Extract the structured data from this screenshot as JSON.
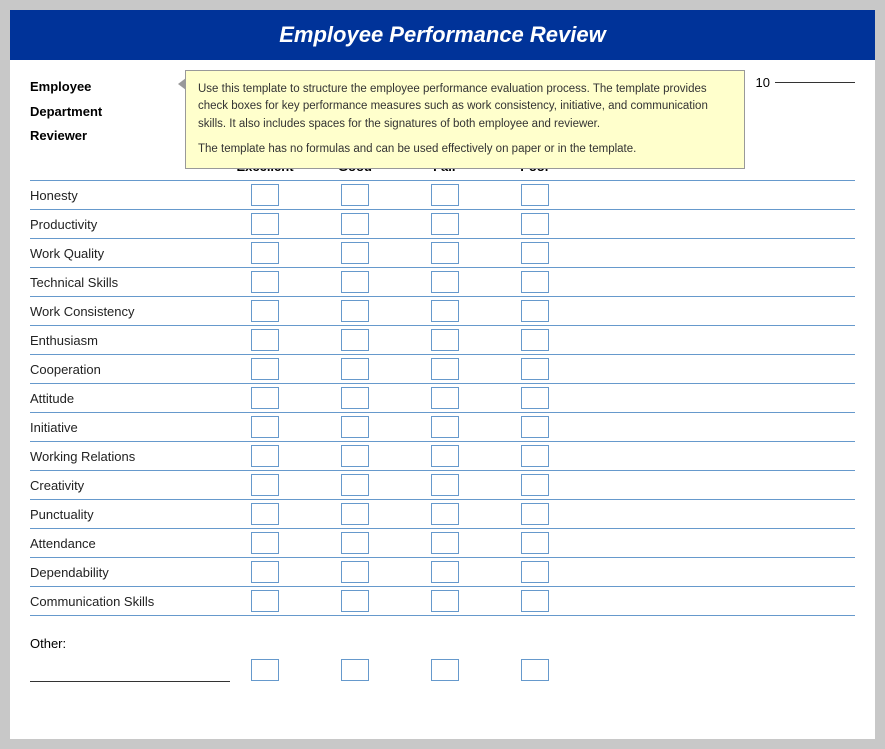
{
  "title": "Employee Performance Review",
  "header": {
    "employee_label": "Employee",
    "department_label": "Department",
    "reviewer_label": "Reviewer",
    "date_label": "10"
  },
  "tooltip": {
    "para1": "Use this template to structure the employee performance evaluation process. The template provides check boxes for key performance measures such as work consistency, initiative, and communication skills. It also includes spaces for the signatures of both employee and reviewer.",
    "para2": "The template has no formulas and can be used effectively on paper or in the template."
  },
  "ratings": {
    "excellent": "Excellent",
    "good": "Good",
    "fair": "Fair",
    "poor": "Poor"
  },
  "criteria": [
    "Honesty",
    "Productivity",
    "Work Quality",
    "Technical Skills",
    "Work Consistency",
    "Enthusiasm",
    "Cooperation",
    "Attitude",
    "Initiative",
    "Working Relations",
    "Creativity",
    "Punctuality",
    "Attendance",
    "Dependability",
    "Communication Skills"
  ],
  "other": {
    "label": "Other:"
  }
}
